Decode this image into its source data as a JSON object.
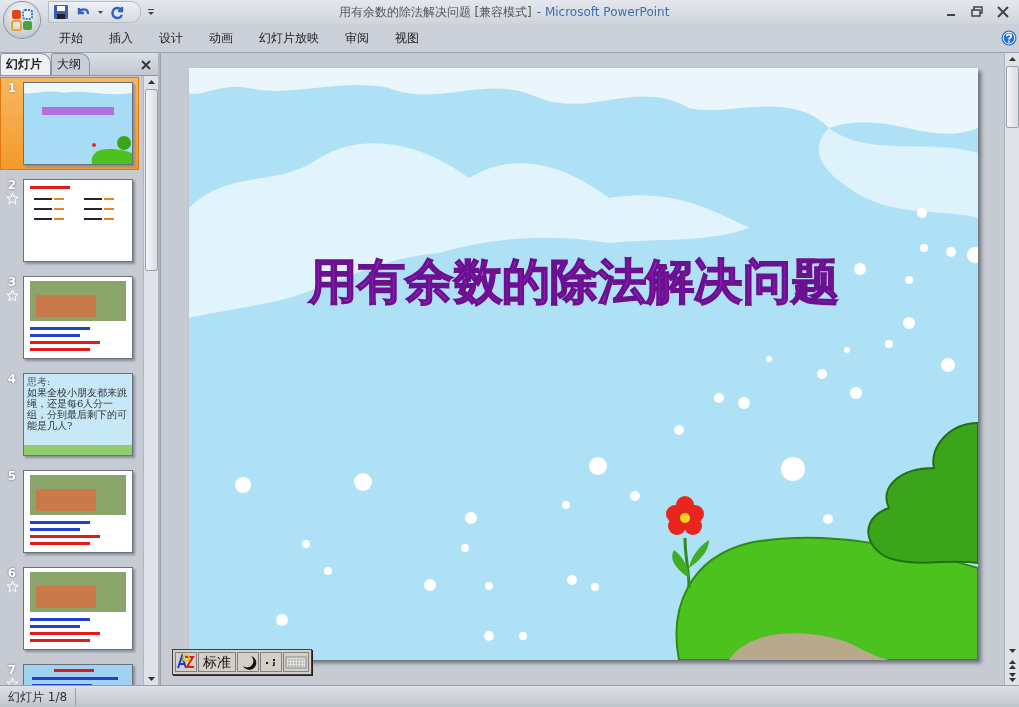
{
  "window": {
    "title": "用有余数的除法解决问题 [兼容模式]",
    "app": "- Microsoft PowerPoint"
  },
  "ribbon_tabs": [
    {
      "label": "开始",
      "selected": false
    },
    {
      "label": "插入",
      "selected": false
    },
    {
      "label": "设计",
      "selected": false
    },
    {
      "label": "动画",
      "selected": false
    },
    {
      "label": "幻灯片放映",
      "selected": false
    },
    {
      "label": "审阅",
      "selected": false
    },
    {
      "label": "视图",
      "selected": false
    }
  ],
  "panel_tabs": [
    {
      "label": "幻灯片",
      "selected": true
    },
    {
      "label": "大纲",
      "selected": false
    }
  ],
  "slides": [
    {
      "number": "1",
      "selected": true,
      "animated": false,
      "kind": "title"
    },
    {
      "number": "2",
      "selected": false,
      "animated": true,
      "kind": "sheet"
    },
    {
      "number": "3",
      "selected": false,
      "animated": true,
      "kind": "picture"
    },
    {
      "number": "4",
      "selected": false,
      "animated": false,
      "kind": "text",
      "heading": "思考:",
      "body": "如果全校小朋友都来跳绳，还是每6人分一组，分到最后剩下的可能是几人?"
    },
    {
      "number": "5",
      "selected": false,
      "animated": false,
      "kind": "picture"
    },
    {
      "number": "6",
      "selected": false,
      "animated": true,
      "kind": "picture"
    },
    {
      "number": "7",
      "selected": false,
      "animated": true,
      "kind": "banner"
    }
  ],
  "slide": {
    "title": "用有余数的除法解决问题"
  },
  "ime": {
    "mode": "标准"
  },
  "status_bar": {
    "slide_info": "幻灯片 1/8"
  }
}
